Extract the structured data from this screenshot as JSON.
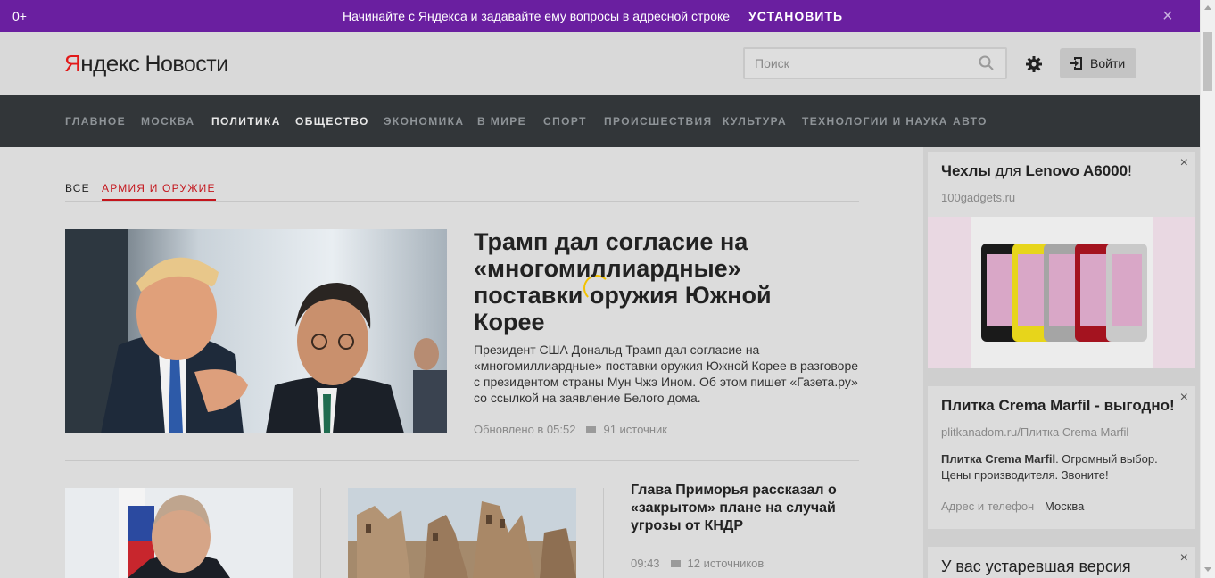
{
  "promo": {
    "age": "0+",
    "message": "Начинайте с Яндекса и задавайте ему вопросы в адресной строке",
    "install": "УСТАНОВИТЬ",
    "close": "×"
  },
  "header": {
    "logo_y": "Я",
    "logo_rest": "ндекс",
    "logo_news": "Новости",
    "search_placeholder": "Поиск",
    "login": "Войти"
  },
  "nav": [
    {
      "label": "ГЛАВНОЕ",
      "active": false
    },
    {
      "label": "МОСКВА",
      "active": false
    },
    {
      "label": "ПОЛИТИКА",
      "active": true
    },
    {
      "label": "ОБЩЕСТВО",
      "active": true
    },
    {
      "label": "ЭКОНОМИКА",
      "active": false
    },
    {
      "label": "В МИРЕ",
      "active": false
    },
    {
      "label": "СПОРТ",
      "active": false
    },
    {
      "label": "ПРОИСШЕСТВИЯ",
      "active": false
    },
    {
      "label": "КУЛЬТУРА",
      "active": false
    },
    {
      "label": "ТЕХНОЛОГИИ И НАУКА",
      "active": false
    },
    {
      "label": "АВТО",
      "active": false
    }
  ],
  "subtabs": {
    "all": "ВСЕ",
    "army": "АРМИЯ И ОРУЖИЕ"
  },
  "hero": {
    "title": "Трамп дал согласие на «многомиллиардные» поставки оружия Южной Корее",
    "text": "Президент США Дональд Трамп дал согласие на «многомиллиардные» поставки оружия Южной Корее в разговоре с президентом страны Мун Чжэ Ином. Об этом пишет «Газета.ру» со ссылкой на заявление Белого дома.",
    "updated": "Обновлено в 05:52",
    "sources": "91 источник"
  },
  "story2": {
    "title": "Глава Приморья рассказал о «закрытом» плане на случай угрозы от КНДР",
    "time": "09:43",
    "sources": "12 источников"
  },
  "ads": {
    "ad1": {
      "title_a": "Чехлы",
      "title_b": " для ",
      "title_c": "Lenovo A6000",
      "title_d": "!",
      "domain": "100gadgets.ru"
    },
    "ad2": {
      "title": "Плитка Crema Marfil - выгодно!",
      "domain": "plitkanadom.ru/Плитка Crema Marfil",
      "desc_bold": "Плитка Crema Marfil",
      "desc_rest": ". Огромный выбор. Цены производителя. Звоните!",
      "contacts": "Адрес и телефон",
      "city": "Москва"
    },
    "ad3": {
      "title": "У вас устаревшая версия"
    }
  },
  "colors": {
    "promo_bg": "#6a1fa0",
    "nav_bg": "#323639",
    "accent_red": "#c4151c",
    "page_bg": "#dcdcdc"
  }
}
